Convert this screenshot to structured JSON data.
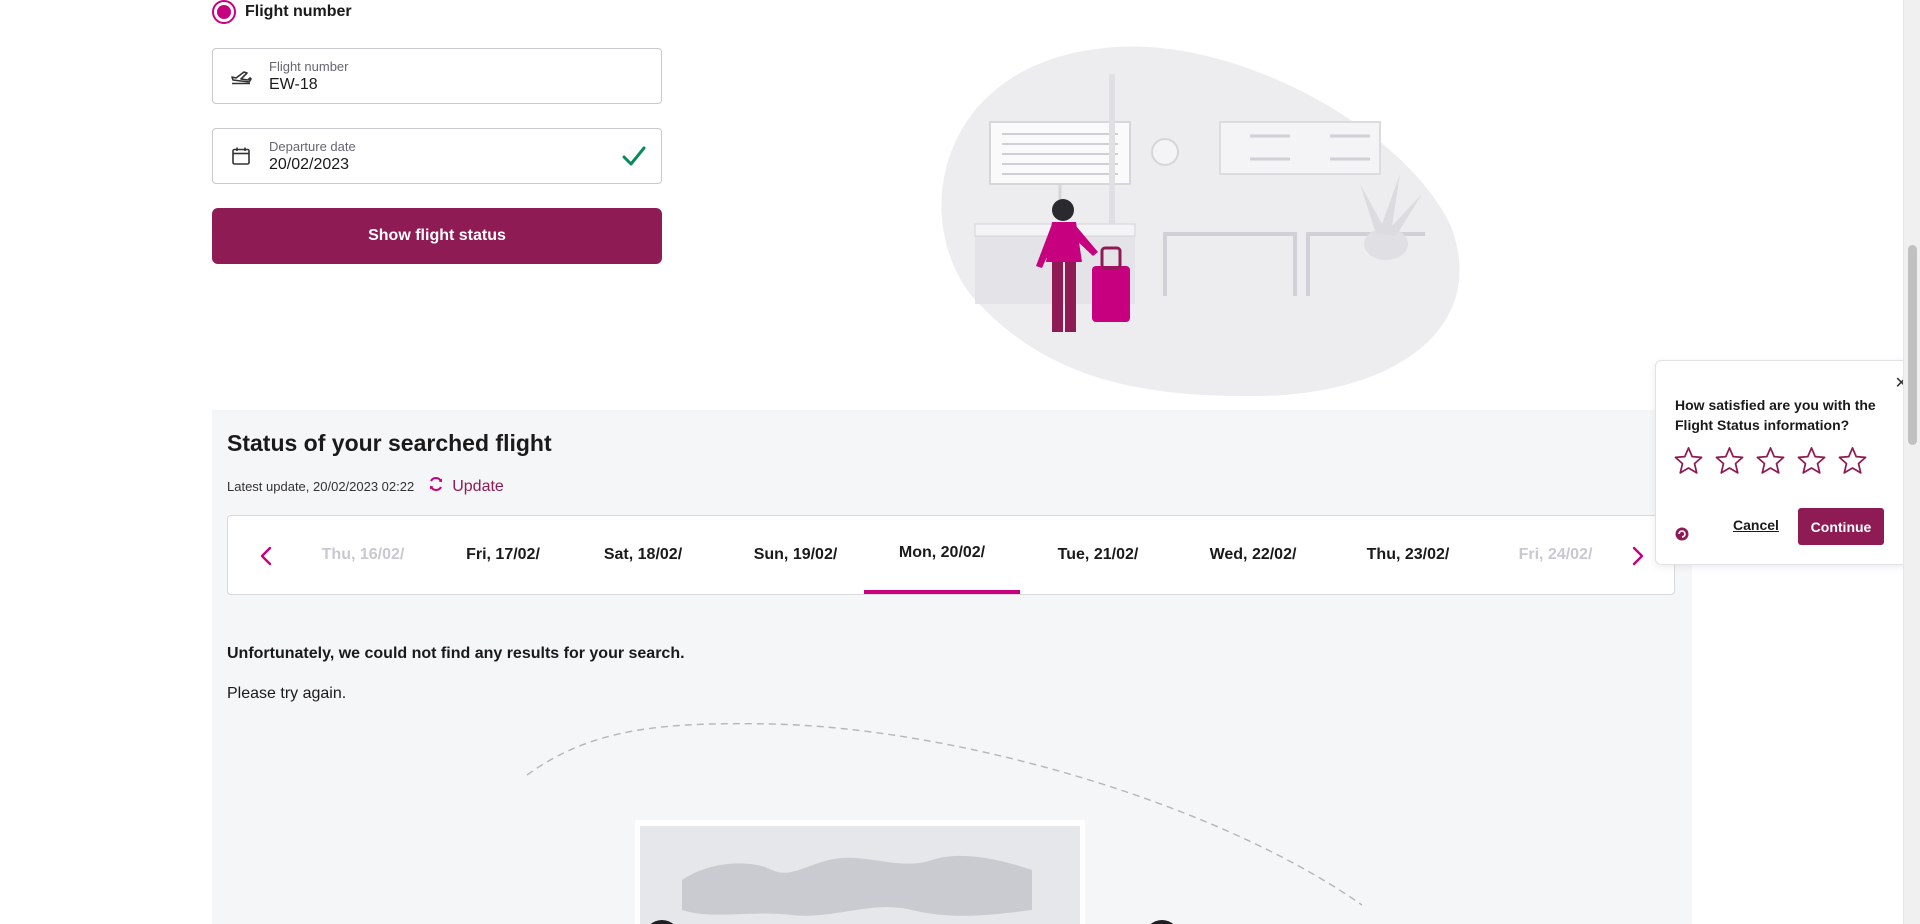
{
  "search": {
    "radio_label": "Flight number",
    "flight_field": {
      "label": "Flight number",
      "value": "EW-18"
    },
    "date_field": {
      "label": "Departure date",
      "value": "20/02/2023"
    },
    "submit_label": "Show flight status"
  },
  "status": {
    "title": "Status of your searched flight",
    "latest_update": "Latest update, 20/02/2023 02:22",
    "update_label": "Update",
    "dates": [
      {
        "label": "Thu, 16/02/",
        "state": "disabled"
      },
      {
        "label": "Fri, 17/02/",
        "state": "normal"
      },
      {
        "label": "Sat, 18/02/",
        "state": "normal"
      },
      {
        "label": "Sun, 19/02/",
        "state": "normal"
      },
      {
        "label": "Mon, 20/02/",
        "state": "active"
      },
      {
        "label": "Tue, 21/02/",
        "state": "normal"
      },
      {
        "label": "Wed, 22/02/",
        "state": "normal"
      },
      {
        "label": "Thu, 23/02/",
        "state": "normal"
      },
      {
        "label": "Fri, 24/02/",
        "state": "disabled"
      }
    ],
    "no_results": "Unfortunately, we could not find any results for your search.",
    "try_again": "Please try again."
  },
  "feedback": {
    "question": "How satisfied are you with the Flight Status information?",
    "stars_total": 5,
    "cancel_label": "Cancel",
    "continue_label": "Continue"
  },
  "colors": {
    "brand": "#8e1b54",
    "accent": "#c6007e",
    "success": "#0a8a5a",
    "panel_bg": "#f5f6f8"
  },
  "icons": {
    "flight_field": "airplane-takeoff-icon",
    "date_field": "calendar-icon",
    "date_valid": "checkmark-icon",
    "update": "refresh-icon",
    "prev": "chevron-left-icon",
    "next": "chevron-right-icon",
    "close": "close-icon",
    "star": "star-outline-icon"
  }
}
